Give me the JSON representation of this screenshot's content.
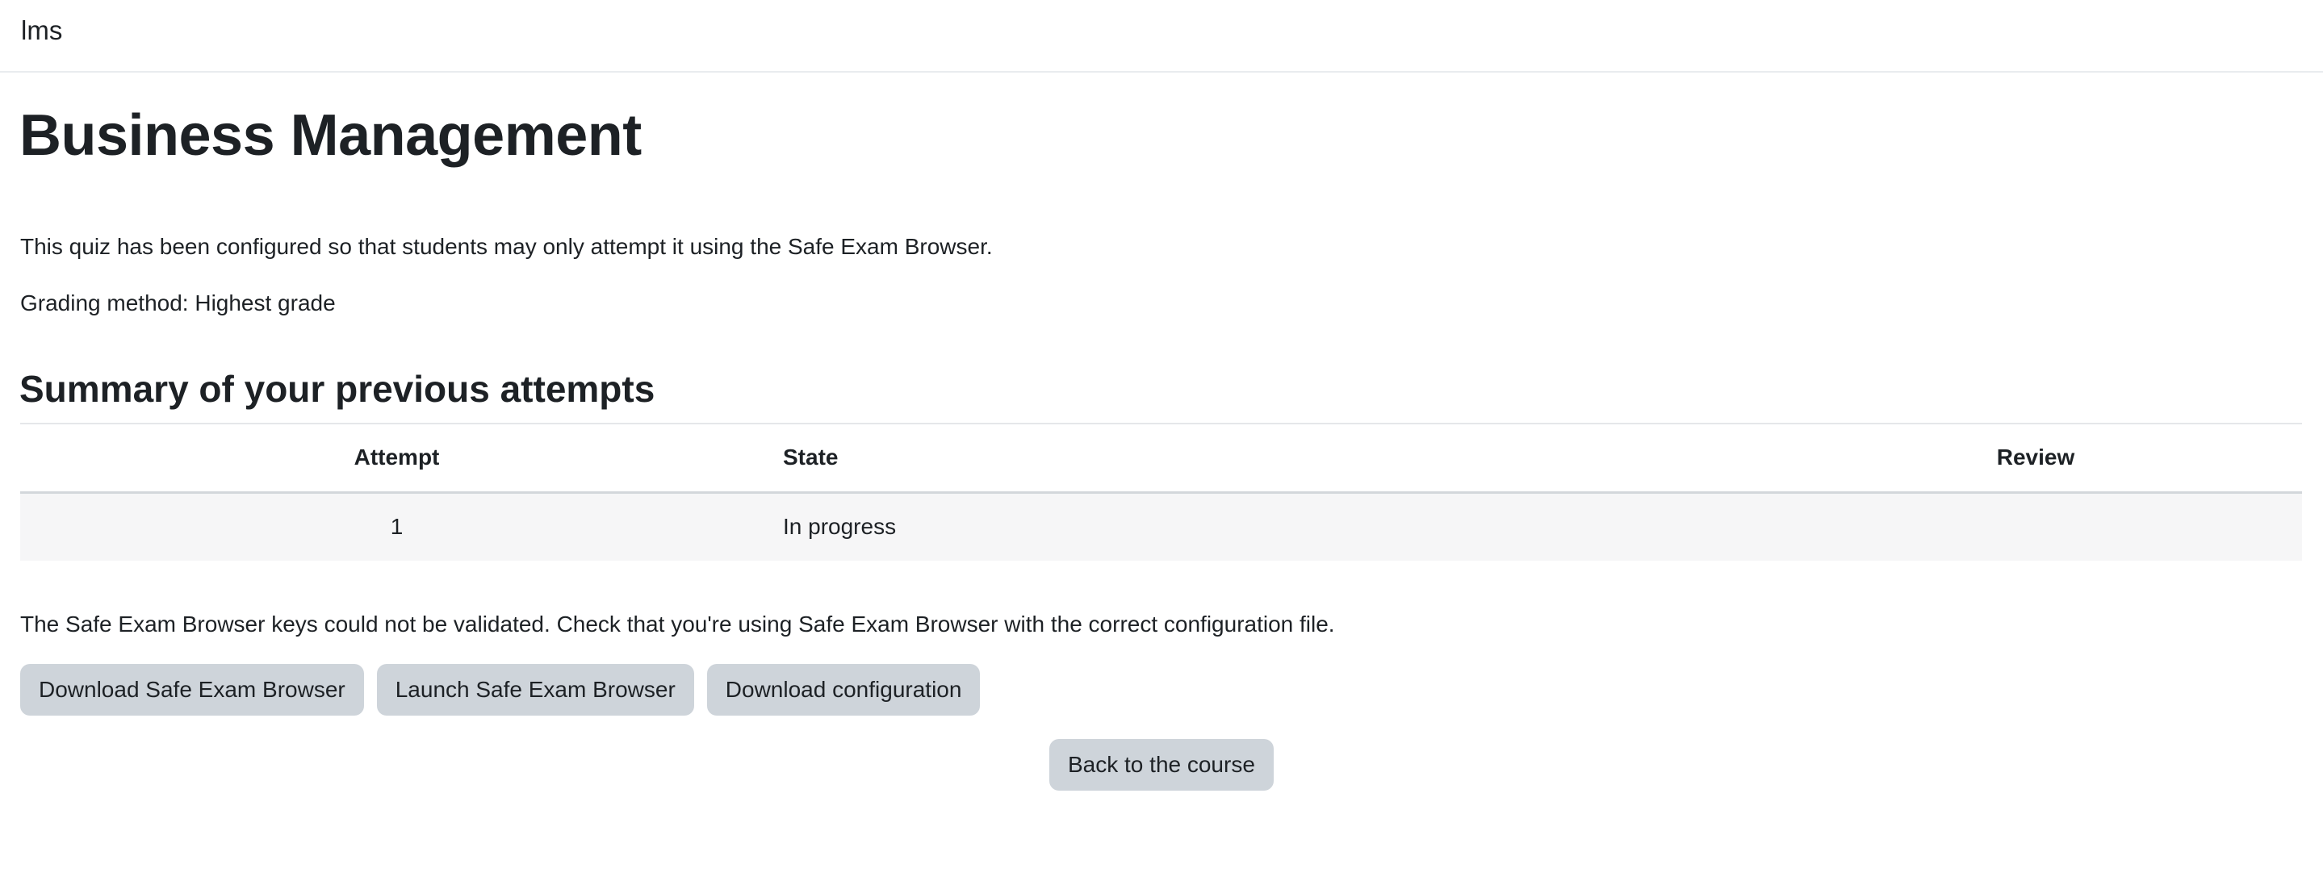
{
  "navbar": {
    "brand": "lms"
  },
  "page": {
    "title": "Business Management",
    "intro": "This quiz has been configured so that students may only attempt it using the Safe Exam Browser.",
    "grading_method": "Grading method: Highest grade"
  },
  "attempts": {
    "heading": "Summary of your previous attempts",
    "columns": {
      "attempt": "Attempt",
      "state": "State",
      "review": "Review"
    },
    "rows": [
      {
        "attempt": "1",
        "state": "In progress",
        "review": ""
      }
    ]
  },
  "seb": {
    "message": "The Safe Exam Browser keys could not be validated. Check that you're using Safe Exam Browser with the correct configuration file.",
    "download_browser_label": "Download Safe Exam Browser",
    "launch_browser_label": "Launch Safe Exam Browser",
    "download_config_label": "Download configuration"
  },
  "navigation": {
    "back_label": "Back to the course"
  },
  "colors": {
    "button_bg": "#ced4da",
    "text": "#1d2125",
    "row_bg": "#f6f6f7"
  }
}
